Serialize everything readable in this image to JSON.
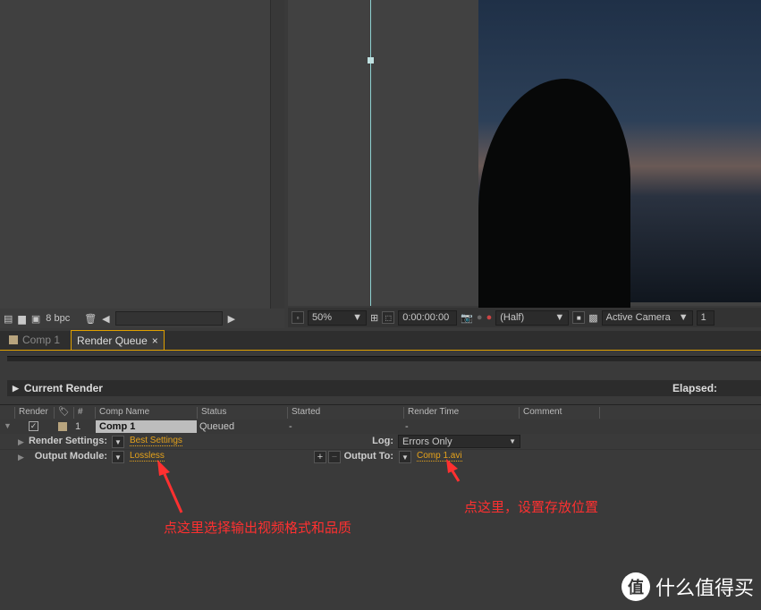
{
  "left_toolbar": {
    "bpc": "8 bpc"
  },
  "viewer_toolbar": {
    "zoom": "50%",
    "timecode": "0:00:00:00",
    "resolution": "(Half)",
    "camera": "Active Camera",
    "views": "1"
  },
  "tabs": [
    {
      "label": "Comp 1"
    },
    {
      "label": "Render Queue"
    }
  ],
  "current_render": {
    "label": "Current Render",
    "elapsed_label": "Elapsed:"
  },
  "columns": [
    "Render",
    "#",
    "Comp Name",
    "Status",
    "Started",
    "Render Time",
    "Comment"
  ],
  "row": {
    "num": "1",
    "comp_name": "Comp 1",
    "status": "Queued",
    "started": "-",
    "render_time": "-"
  },
  "render_settings": {
    "label": "Render Settings:",
    "value": "Best Settings",
    "log_label": "Log:",
    "log_value": "Errors Only"
  },
  "output_module": {
    "label": "Output Module:",
    "value": "Lossless",
    "output_to_label": "Output To:",
    "output_to_value": "Comp 1.avi"
  },
  "annotations": {
    "left": "点这里选择输出视频格式和品质",
    "right": "点这里，设置存放位置"
  },
  "watermark": {
    "text": "什么值得买",
    "logo": "值"
  },
  "colors": {
    "accent": "#e0a000",
    "link": "#e5a21b",
    "annotation": "#ff3030"
  }
}
